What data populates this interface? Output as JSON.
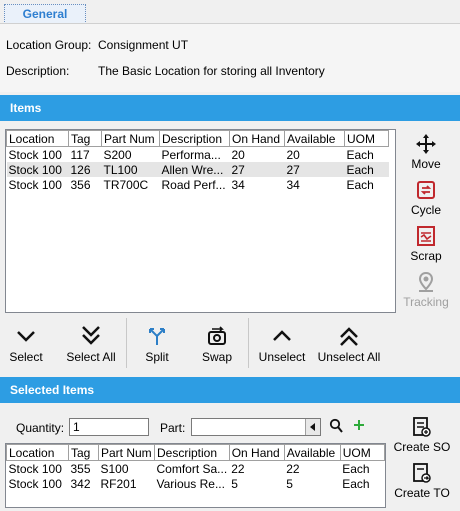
{
  "tab": {
    "label": "General"
  },
  "info": {
    "location_group_label": "Location Group:",
    "location_group_value": "Consignment UT",
    "description_label": "Description:",
    "description_value": "The Basic Location for storing all Inventory"
  },
  "items_section": {
    "title": "Items"
  },
  "items_table": {
    "columns": [
      "Location",
      "Tag",
      "Part Num",
      "Description",
      "On Hand",
      "Available",
      "UOM"
    ],
    "rows": [
      [
        "Stock 100",
        "117",
        "S200",
        "Performa...",
        "20",
        "20",
        "Each"
      ],
      [
        "Stock 100",
        "126",
        "TL100",
        "Allen Wre...",
        "27",
        "27",
        "Each"
      ],
      [
        "Stock 100",
        "356",
        "TR700C",
        "Road Perf...",
        "34",
        "34",
        "Each"
      ]
    ]
  },
  "side_actions": {
    "move": "Move",
    "cycle": "Cycle",
    "scrap": "Scrap",
    "tracking": "Tracking"
  },
  "toolbar": {
    "select": "Select",
    "select_all": "Select All",
    "split": "Split",
    "swap": "Swap",
    "unselect": "Unselect",
    "unselect_all": "Unselect All"
  },
  "selected_section": {
    "title": "Selected Items"
  },
  "filters": {
    "quantity_label": "Quantity:",
    "quantity_value": "1",
    "part_label": "Part:",
    "part_value": ""
  },
  "selected_table": {
    "columns": [
      "Location",
      "Tag",
      "Part Num",
      "Description",
      "On Hand",
      "Available",
      "UOM"
    ],
    "rows": [
      [
        "Stock 100",
        "355",
        "S100",
        "Comfort Sa...",
        "22",
        "22",
        "Each"
      ],
      [
        "Stock 100",
        "342",
        "RF201",
        "Various Re...",
        "5",
        "5",
        "Each"
      ]
    ]
  },
  "create_actions": {
    "create_so": "Create SO",
    "create_to": "Create TO"
  },
  "colors": {
    "accent": "#2d9de3",
    "danger": "#c0282d",
    "disabled": "#a0a0a0",
    "add": "#2eaa3a"
  }
}
